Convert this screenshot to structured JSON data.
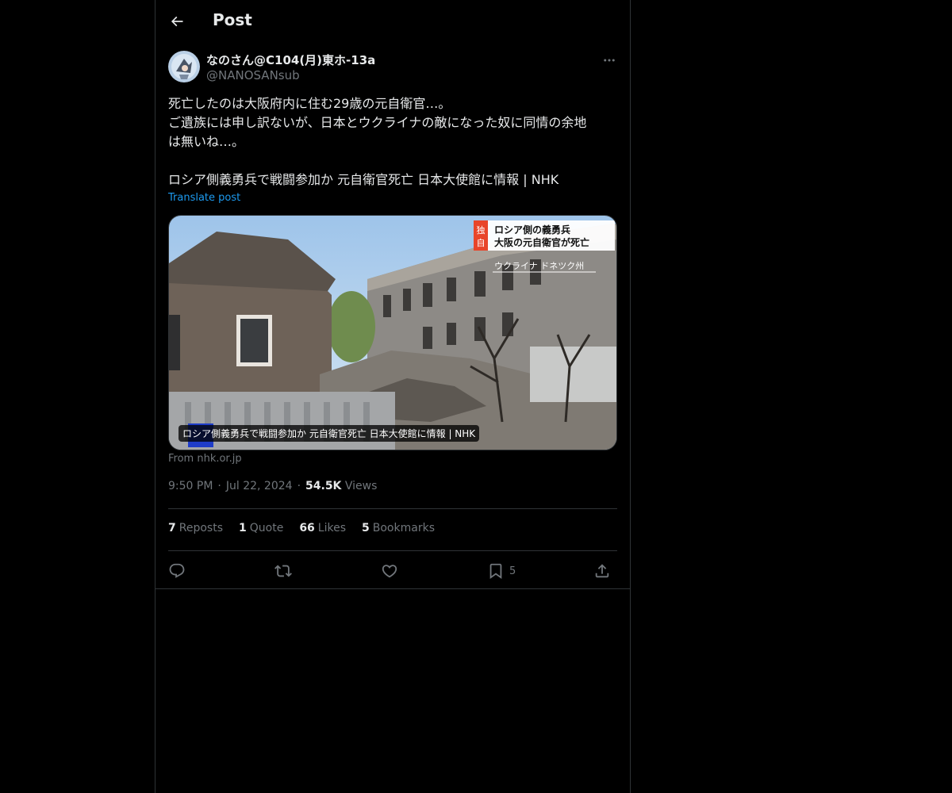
{
  "header": {
    "title": "Post"
  },
  "author": {
    "name": "なのさん@C104(月)東ホ-13a",
    "handle": "@NANOSANsub"
  },
  "post": {
    "lines": [
      "死亡したのは大阪府内に住む29歳の元自衛官…。",
      "ご遺族には申し訳ないが、日本とウクライナの敵になった奴に同情の余地",
      "は無いね…。",
      "ロシア側義勇兵で戦闘参加か 元自衛官死亡 日本大使館に情報 | NHK"
    ],
    "translate_label": "Translate post"
  },
  "card": {
    "caption": "ロシア側義勇兵で戦闘参加か 元自衛官死亡 日本大使館に情報 | NHK",
    "source": "From nhk.or.jp",
    "image_badge": "独自",
    "image_headline_1": "ロシア側の義勇兵",
    "image_headline_2": "大阪の元自衛官が死亡",
    "image_location": "ウクライナ ドネツク州"
  },
  "meta": {
    "time": "9:50 PM",
    "date": "Jul 22, 2024",
    "views_count": "54.5K",
    "views_label": "Views"
  },
  "stats": [
    {
      "count": "7",
      "label": "Reposts"
    },
    {
      "count": "1",
      "label": "Quote"
    },
    {
      "count": "66",
      "label": "Likes"
    },
    {
      "count": "5",
      "label": "Bookmarks"
    }
  ],
  "actions": {
    "bookmark_count": "5"
  },
  "icons": [
    "back-arrow-icon",
    "more-icon",
    "reply-icon",
    "repost-icon",
    "like-icon",
    "bookmark-icon",
    "share-icon"
  ],
  "colors": {
    "background": "#000000",
    "text": "#e7e9ea",
    "secondary": "#71767b",
    "link": "#1d9bf0",
    "border": "#2f3336"
  }
}
